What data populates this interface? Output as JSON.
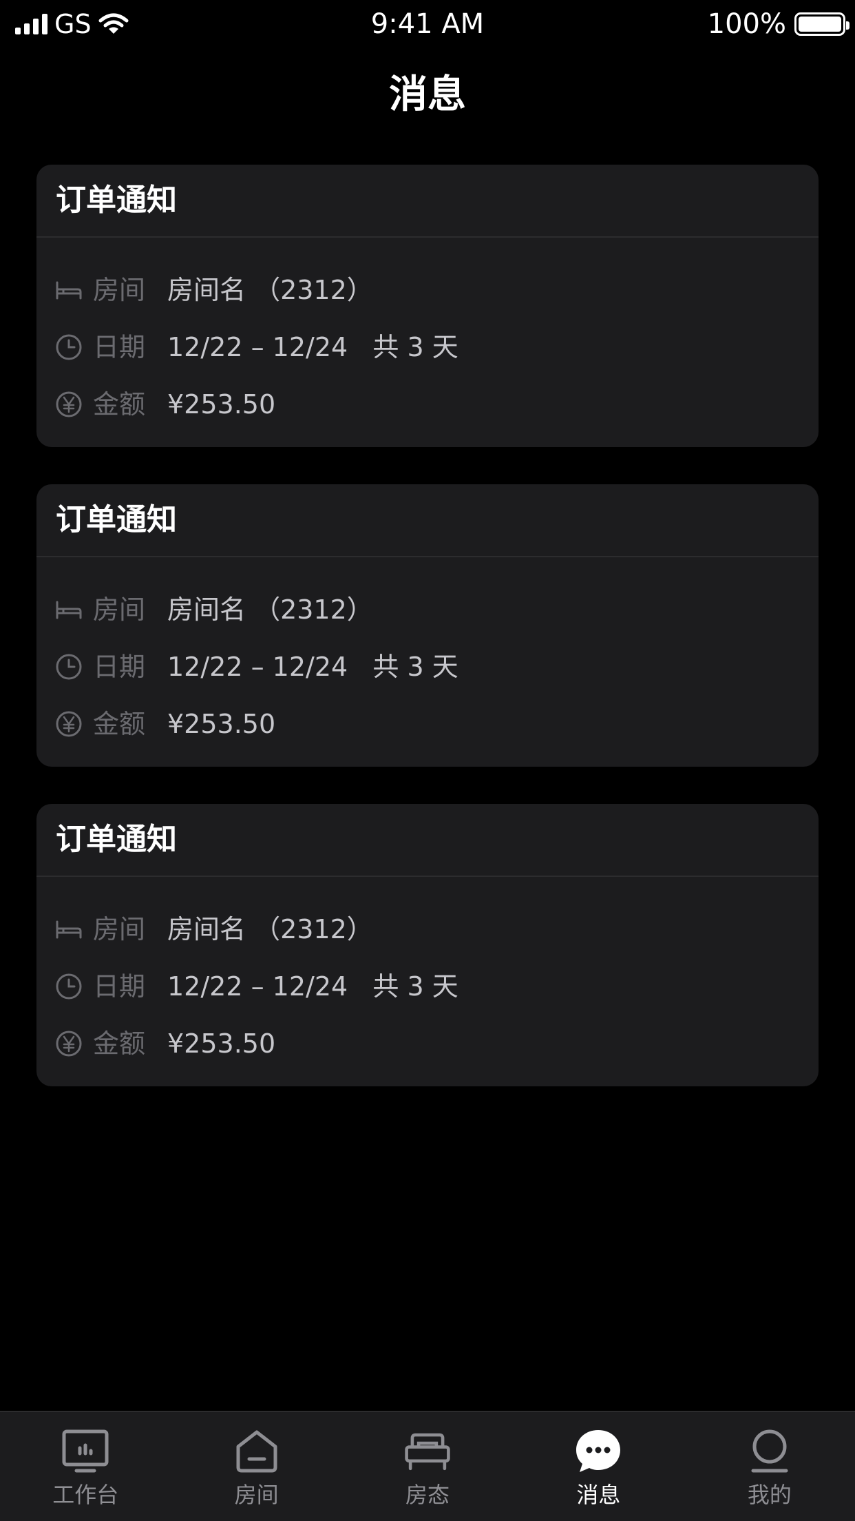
{
  "status_bar": {
    "carrier": "GS",
    "time": "9:41 AM",
    "battery": "100%"
  },
  "page_title": "消息",
  "cards": [
    {
      "title": "订单通知",
      "room_label": "房间",
      "room_value": "房间名 （2312）",
      "date_label": "日期",
      "date_value": "12/22 – 12/24   共 3 天",
      "amount_label": "金额",
      "amount_value": "¥253.50"
    },
    {
      "title": "订单通知",
      "room_label": "房间",
      "room_value": "房间名 （2312）",
      "date_label": "日期",
      "date_value": "12/22 – 12/24   共 3 天",
      "amount_label": "金额",
      "amount_value": "¥253.50"
    },
    {
      "title": "订单通知",
      "room_label": "房间",
      "room_value": "房间名 （2312）",
      "date_label": "日期",
      "date_value": "12/22 – 12/24   共 3 天",
      "amount_label": "金额",
      "amount_value": "¥253.50"
    }
  ],
  "tabs": [
    {
      "label": "工作台",
      "icon": "monitor-icon"
    },
    {
      "label": "房间",
      "icon": "house-icon"
    },
    {
      "label": "房态",
      "icon": "bed-icon"
    },
    {
      "label": "消息",
      "icon": "chat-bubble-icon",
      "active": true
    },
    {
      "label": "我的",
      "icon": "person-icon"
    }
  ],
  "colors": {
    "background": "#000000",
    "card": "#1c1c1e",
    "tab_bar": "#1c1c1e",
    "active": "#ffffff",
    "inactive": "#8e8e93"
  }
}
